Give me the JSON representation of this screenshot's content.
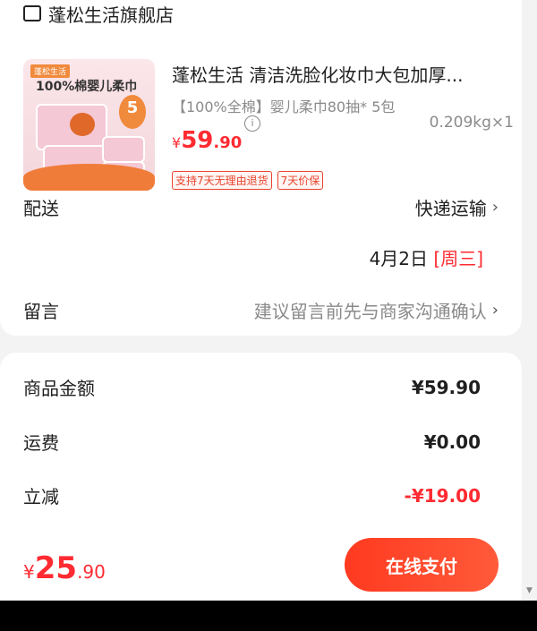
{
  "store": {
    "name": "蓬松生活旗舰店"
  },
  "product": {
    "thumb_brand": "蓬松生活",
    "thumb_headline": "100%棉婴儿柔巾",
    "thumb_badge": "5",
    "title": "蓬松生活 清洁洗脸化妆巾大包加厚...",
    "spec": "【100%全棉】婴儿柔巾80抽* 5包",
    "price": {
      "currency": "¥",
      "integer": "59",
      "decimal": ".90"
    },
    "info_icon": "i",
    "weight": "0.209kg×1",
    "tags": [
      "支持7天无理由退货",
      "7天价保"
    ]
  },
  "delivery": {
    "label": "配送",
    "method": "快递运输",
    "date": "4月2日",
    "weekday": "[周三]"
  },
  "message": {
    "label": "留言",
    "placeholder": "建议留言前先与商家沟通确认"
  },
  "summary": {
    "rows": [
      {
        "label": "商品金额",
        "value": "¥59.90"
      },
      {
        "label": "运费",
        "value": "¥0.00"
      },
      {
        "label": "立减",
        "value": "-¥19.00"
      }
    ]
  },
  "bottom": {
    "total": {
      "currency": "¥",
      "integer": "25",
      "decimal": ".90"
    },
    "pay_label": "在线支付"
  },
  "colors": {
    "accent": "#ff2b32",
    "pay_button": "#ff3a20"
  },
  "chevron": "›"
}
